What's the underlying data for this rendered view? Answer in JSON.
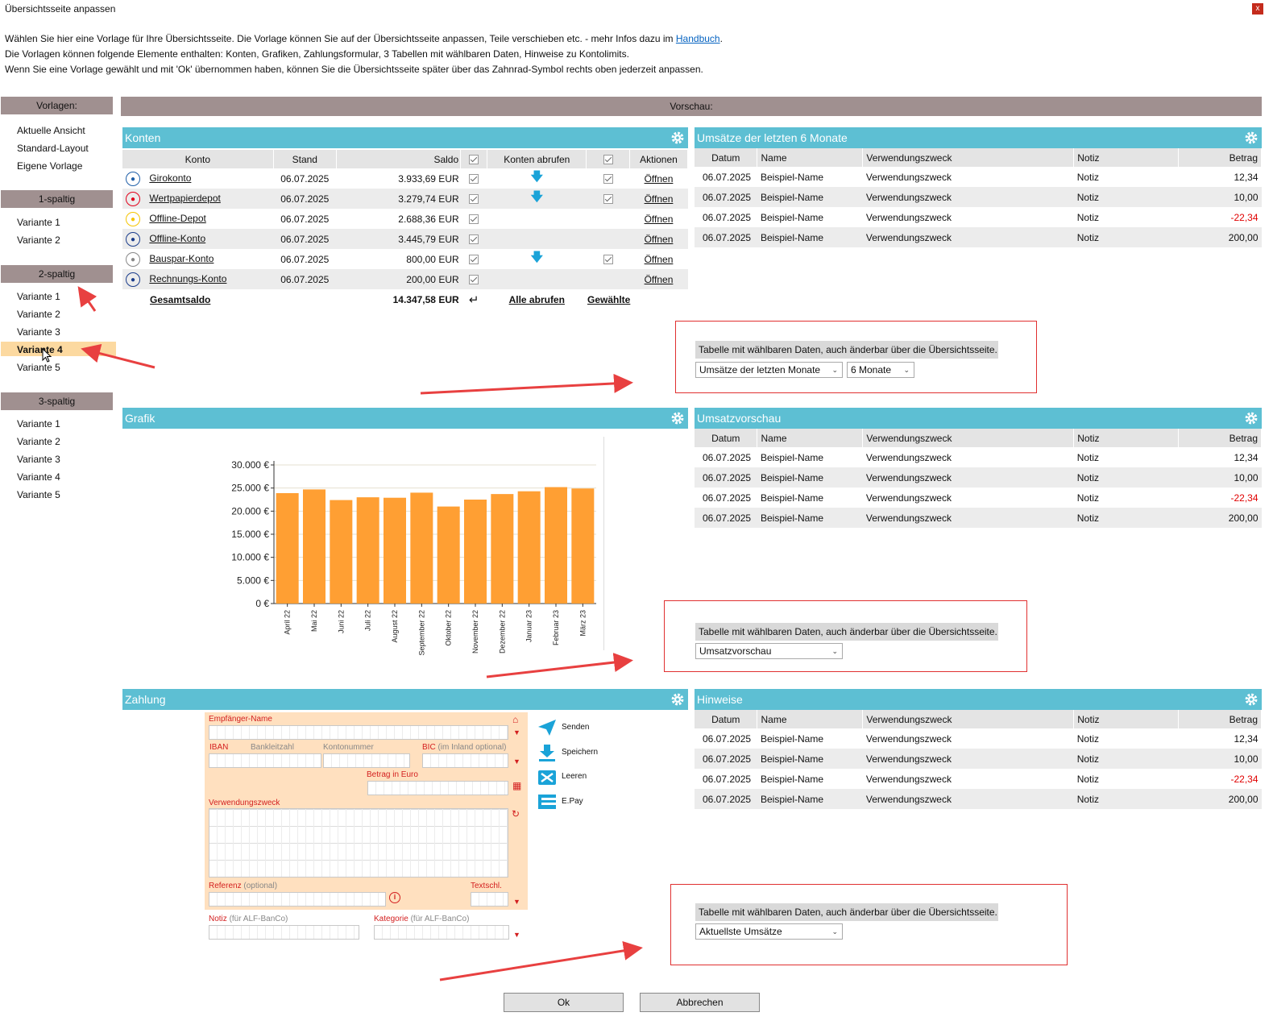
{
  "window": {
    "title": "Übersichtsseite anpassen",
    "close": "x"
  },
  "intro": {
    "line1_text": "Wählen Sie hier eine Vorlage für Ihre Übersichtsseite. Die Vorlage können Sie auf der Übersichtsseite anpassen, Teile verschieben etc. - mehr Infos dazu im ",
    "line1_link": "Handbuch",
    "line1_end": ".",
    "line2": "Die Vorlagen können folgende Elemente enthalten: Konten, Grafiken, Zahlungsformular, 3 Tabellen mit wählbaren Daten, Hinweise zu Kontolimits.",
    "line3": "Wenn Sie eine Vorlage gewählt und mit 'Ok' übernommen haben, können Sie die Übersichtsseite später über das Zahnrad-Symbol rechts oben jederzeit anpassen."
  },
  "sidebar": {
    "head": "Vorlagen:",
    "top_items": [
      "Aktuelle Ansicht",
      "Standard-Layout",
      "Eigene Vorlage"
    ],
    "groups": [
      {
        "head": "1-spaltig",
        "items": [
          "Variante 1",
          "Variante 2"
        ]
      },
      {
        "head": "2-spaltig",
        "items": [
          "Variante 1",
          "Variante 2",
          "Variante 3",
          "Variante 4",
          "Variante 5"
        ],
        "selected": "Variante 4"
      },
      {
        "head": "3-spaltig",
        "items": [
          "Variante 1",
          "Variante 2",
          "Variante 3",
          "Variante 4",
          "Variante 5"
        ]
      }
    ]
  },
  "preview": {
    "head": "Vorschau:"
  },
  "konten": {
    "title": "Konten",
    "cols": [
      "Konto",
      "Stand",
      "Saldo",
      "Konten abrufen",
      "Aktionen"
    ],
    "rows": [
      {
        "name": "Girokonto",
        "stand": "06.07.2025",
        "saldo": "3.933,69 EUR",
        "abruf": true,
        "action": "Öffnen",
        "icon": "volksbank-icon",
        "ic": "#1f5fa8"
      },
      {
        "name": "Wertpapierdepot",
        "stand": "06.07.2025",
        "saldo": "3.279,74 EUR",
        "abruf": true,
        "action": "Öffnen",
        "icon": "sparkasse-icon",
        "ic": "#e2001a"
      },
      {
        "name": "Offline-Depot",
        "stand": "06.07.2025",
        "saldo": "2.688,36 EUR",
        "abruf": false,
        "action": "Öffnen",
        "icon": "offline-depot-icon",
        "ic": "#f5c400"
      },
      {
        "name": "Offline-Konto",
        "stand": "06.07.2025",
        "saldo": "3.445,79 EUR",
        "abruf": false,
        "action": "Öffnen",
        "icon": "offline-konto-icon",
        "ic": "#1a3c8c"
      },
      {
        "name": "Bauspar-Konto",
        "stand": "06.07.2025",
        "saldo": "800,00 EUR",
        "abruf": true,
        "action": "Öffnen",
        "icon": "bank-building-icon",
        "ic": "#888888"
      },
      {
        "name": "Rechnungs-Konto",
        "stand": "06.07.2025",
        "saldo": "200,00 EUR",
        "abruf": false,
        "action": "Öffnen",
        "icon": "rechnung-icon",
        "ic": "#1a3c8c"
      }
    ],
    "total_label": "Gesamtsaldo",
    "total": "14.347,58 EUR",
    "alle": "Alle abrufen",
    "gewaehlte": "Gewählte"
  },
  "tables": [
    {
      "title": "Umsätze der letzten 6 Monate",
      "cols": [
        "Datum",
        "Name",
        "Verwendungszweck",
        "Notiz",
        "Betrag"
      ],
      "rows": [
        [
          "06.07.2025",
          "Beispiel-Name",
          "Verwendungszweck",
          "Notiz",
          "12,34"
        ],
        [
          "06.07.2025",
          "Beispiel-Name",
          "Verwendungszweck",
          "Notiz",
          "10,00"
        ],
        [
          "06.07.2025",
          "Beispiel-Name",
          "Verwendungszweck",
          "Notiz",
          "-22,34"
        ],
        [
          "06.07.2025",
          "Beispiel-Name",
          "Verwendungszweck",
          "Notiz",
          "200,00"
        ]
      ]
    },
    {
      "title": "Umsatzvorschau",
      "cols": [
        "Datum",
        "Name",
        "Verwendungszweck",
        "Notiz",
        "Betrag"
      ],
      "rows": [
        [
          "06.07.2025",
          "Beispiel-Name",
          "Verwendungszweck",
          "Notiz",
          "12,34"
        ],
        [
          "06.07.2025",
          "Beispiel-Name",
          "Verwendungszweck",
          "Notiz",
          "10,00"
        ],
        [
          "06.07.2025",
          "Beispiel-Name",
          "Verwendungszweck",
          "Notiz",
          "-22,34"
        ],
        [
          "06.07.2025",
          "Beispiel-Name",
          "Verwendungszweck",
          "Notiz",
          "200,00"
        ]
      ]
    },
    {
      "title": "Hinweise",
      "cols": [
        "Datum",
        "Name",
        "Verwendungszweck",
        "Notiz",
        "Betrag"
      ],
      "rows": [
        [
          "06.07.2025",
          "Beispiel-Name",
          "Verwendungszweck",
          "Notiz",
          "12,34"
        ],
        [
          "06.07.2025",
          "Beispiel-Name",
          "Verwendungszweck",
          "Notiz",
          "10,00"
        ],
        [
          "06.07.2025",
          "Beispiel-Name",
          "Verwendungszweck",
          "Notiz",
          "-22,34"
        ],
        [
          "06.07.2025",
          "Beispiel-Name",
          "Verwendungszweck",
          "Notiz",
          "200,00"
        ]
      ]
    }
  ],
  "boxes": [
    {
      "label": "Tabelle mit wählbaren Daten, auch änderbar über die Übersichtsseite.",
      "select1": "Umsätze der letzten Monate",
      "select2": "6 Monate"
    },
    {
      "label": "Tabelle mit wählbaren Daten, auch änderbar über die Übersichtsseite.",
      "select1": "Umsatzvorschau"
    },
    {
      "label": "Tabelle mit wählbaren Daten, auch änderbar über die Übersichtsseite.",
      "select1": "Aktuellste Umsätze"
    }
  ],
  "grafik": {
    "title": "Grafik"
  },
  "chart_data": {
    "type": "bar",
    "categories": [
      "April 22",
      "Mai 22",
      "Juni 22",
      "Juli 22",
      "August 22",
      "September 22",
      "Oktober 22",
      "November 22",
      "Dezember 22",
      "Januar 23",
      "Februar 23",
      "März 23"
    ],
    "values": [
      23900,
      24700,
      22400,
      23000,
      22900,
      24000,
      21000,
      22500,
      23700,
      24300,
      25200,
      24900
    ],
    "yticks": [
      "0 €",
      "5.000 €",
      "10.000 €",
      "15.000 €",
      "20.000 €",
      "25.000 €",
      "30.000 €"
    ],
    "ylim": [
      0,
      30000
    ],
    "bar_color": "#ff9f33",
    "grid": true
  },
  "zahlung": {
    "title": "Zahlung",
    "empfaenger": "Empfänger-Name",
    "iban": "IBAN",
    "blz": "Bankleitzahl",
    "kto": "Kontonummer",
    "bic": "BIC",
    "bic_hint": "(im Inland optional)",
    "betrag": "Betrag in Euro",
    "vzweck": "Verwendungszweck",
    "referenz": "Referenz",
    "ref_hint": "(optional)",
    "textschl": "Textschl.",
    "notiz": "Notiz",
    "notiz_hint": "(für ALF-BanCo)",
    "kategorie": "Kategorie",
    "kat_hint": "(für ALF-BanCo)",
    "actions": [
      "Senden",
      "Speichern",
      "Leeren",
      "E.Pay"
    ]
  },
  "buttons": {
    "ok": "Ok",
    "cancel": "Abbrechen"
  },
  "colors": {
    "accent": "#5dbfd3",
    "header_gray": "#a09090",
    "bar": "#ff9f33",
    "highlight": "#fcd9a0",
    "negative": "#e00000"
  }
}
